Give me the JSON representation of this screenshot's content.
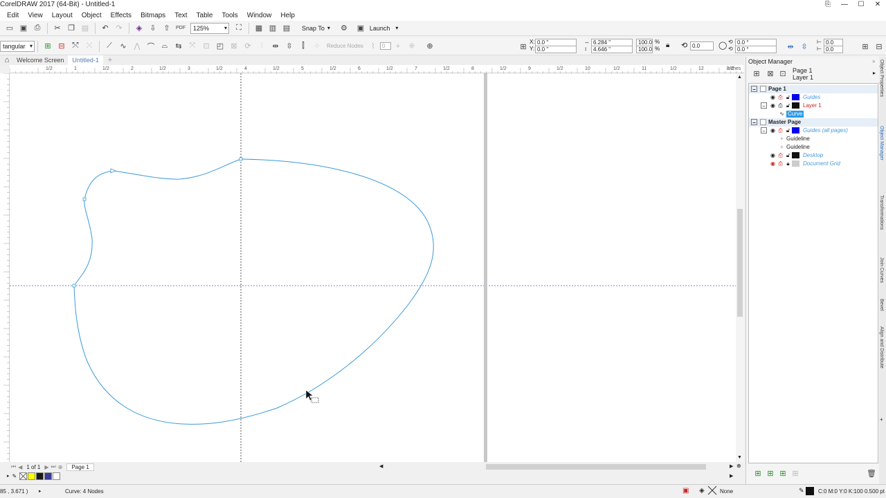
{
  "titlebar": {
    "title": "CorelDRAW 2017 (64-Bit) - Untitled-1",
    "controls": [
      "⎘",
      "—",
      "☐",
      "✕"
    ]
  },
  "menu": [
    "Edit",
    "View",
    "Layout",
    "Object",
    "Effects",
    "Bitmaps",
    "Text",
    "Table",
    "Tools",
    "Window",
    "Help"
  ],
  "toolbar": {
    "zoom": "125%",
    "snap_to": "Snap To",
    "launch": "Launch",
    "mode": "tangular",
    "reduce_nodes": "Reduce Nodes",
    "smoothing": "0"
  },
  "property_bar": {
    "x": "0.0 \"",
    "y": "0.0 \"",
    "width": "6.284 \"",
    "height": "4.646 \"",
    "scale_w": "100.0",
    "scale_h": "100.0",
    "percent": "%",
    "rotation": "0.0",
    "skew_h": "0.0 °",
    "skew_v": "0.0 °",
    "outline1": "0.0",
    "outline2": "0.0",
    "label_x": "X:",
    "label_y": "Y:"
  },
  "tabs": [
    "Welcome Screen",
    "Untitled-1"
  ],
  "ruler_labels": [
    "1/2",
    "1",
    "1/2",
    "2",
    "1/2",
    "3",
    "1/2",
    "4",
    "1/2",
    "5",
    "1/2",
    "6",
    "1/2",
    "7",
    "1/2",
    "8",
    "1/2",
    "9",
    "1/2",
    "10",
    "1/2",
    "11",
    "1/2",
    "12",
    "1/2",
    "inches"
  ],
  "bottombar": {
    "page_counter": "1 of 1",
    "page_tab": "Page 1"
  },
  "palette": {
    "colors": [
      "#ffffff",
      "#ffff00",
      "#1a1a1a",
      "#3a3a9a",
      "#ffffff"
    ]
  },
  "status": {
    "coords": "85 , 3.671 )",
    "info": "Curve: 4 Nodes",
    "fill": "None",
    "outline": "C:0 M:0 Y:0 K:100  0.500 pt"
  },
  "object_manager": {
    "title": "Object Manager",
    "current_page": "Page 1",
    "current_layer": "Layer 1",
    "page1": "Page 1",
    "guides": "Guides",
    "layer1": "Layer 1",
    "curve": "Curve",
    "master_page": "Master Page",
    "guides_all": "Guides (all pages)",
    "guideline1": "Guideline",
    "guideline2": "Guideline",
    "desktop": "Desktop",
    "document_grid": "Document Grid"
  },
  "docker_tabs": [
    "Object Properties",
    "Object Manager",
    "Transformations",
    "Join Curves",
    "Bevel",
    "Align and Distribute"
  ],
  "colors": {
    "curve": "#3a9ad8",
    "guide_h": "#8080c0",
    "guide_v": "#555555",
    "selected": "#2a9ae8",
    "blue_swatch": "#0000ee",
    "layer_red": "#cc2222"
  }
}
